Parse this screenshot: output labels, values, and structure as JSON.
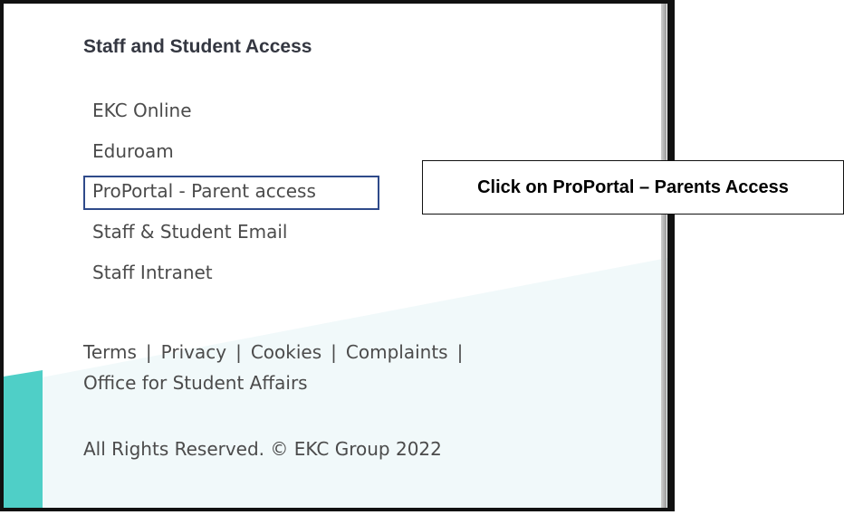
{
  "section_title": "Staff and Student Access",
  "access_links": [
    {
      "label": "EKC Online"
    },
    {
      "label": "Eduroam"
    },
    {
      "label": "ProPortal - Parent access"
    },
    {
      "label": "Staff & Student Email"
    },
    {
      "label": "Staff Intranet"
    }
  ],
  "footer": {
    "links": [
      "Terms",
      "Privacy",
      "Cookies",
      "Complaints"
    ],
    "separator": "|",
    "office_link": "Office for Student Affairs",
    "copyright": "All Rights Reserved. © EKC Group 2022"
  },
  "annotation": {
    "callout_text": "Click on ProPortal – Parents Access"
  },
  "colors": {
    "accent_teal": "#4fcfc7",
    "footer_tint": "#f1f9fa",
    "highlight_border": "#2f4a8a"
  }
}
